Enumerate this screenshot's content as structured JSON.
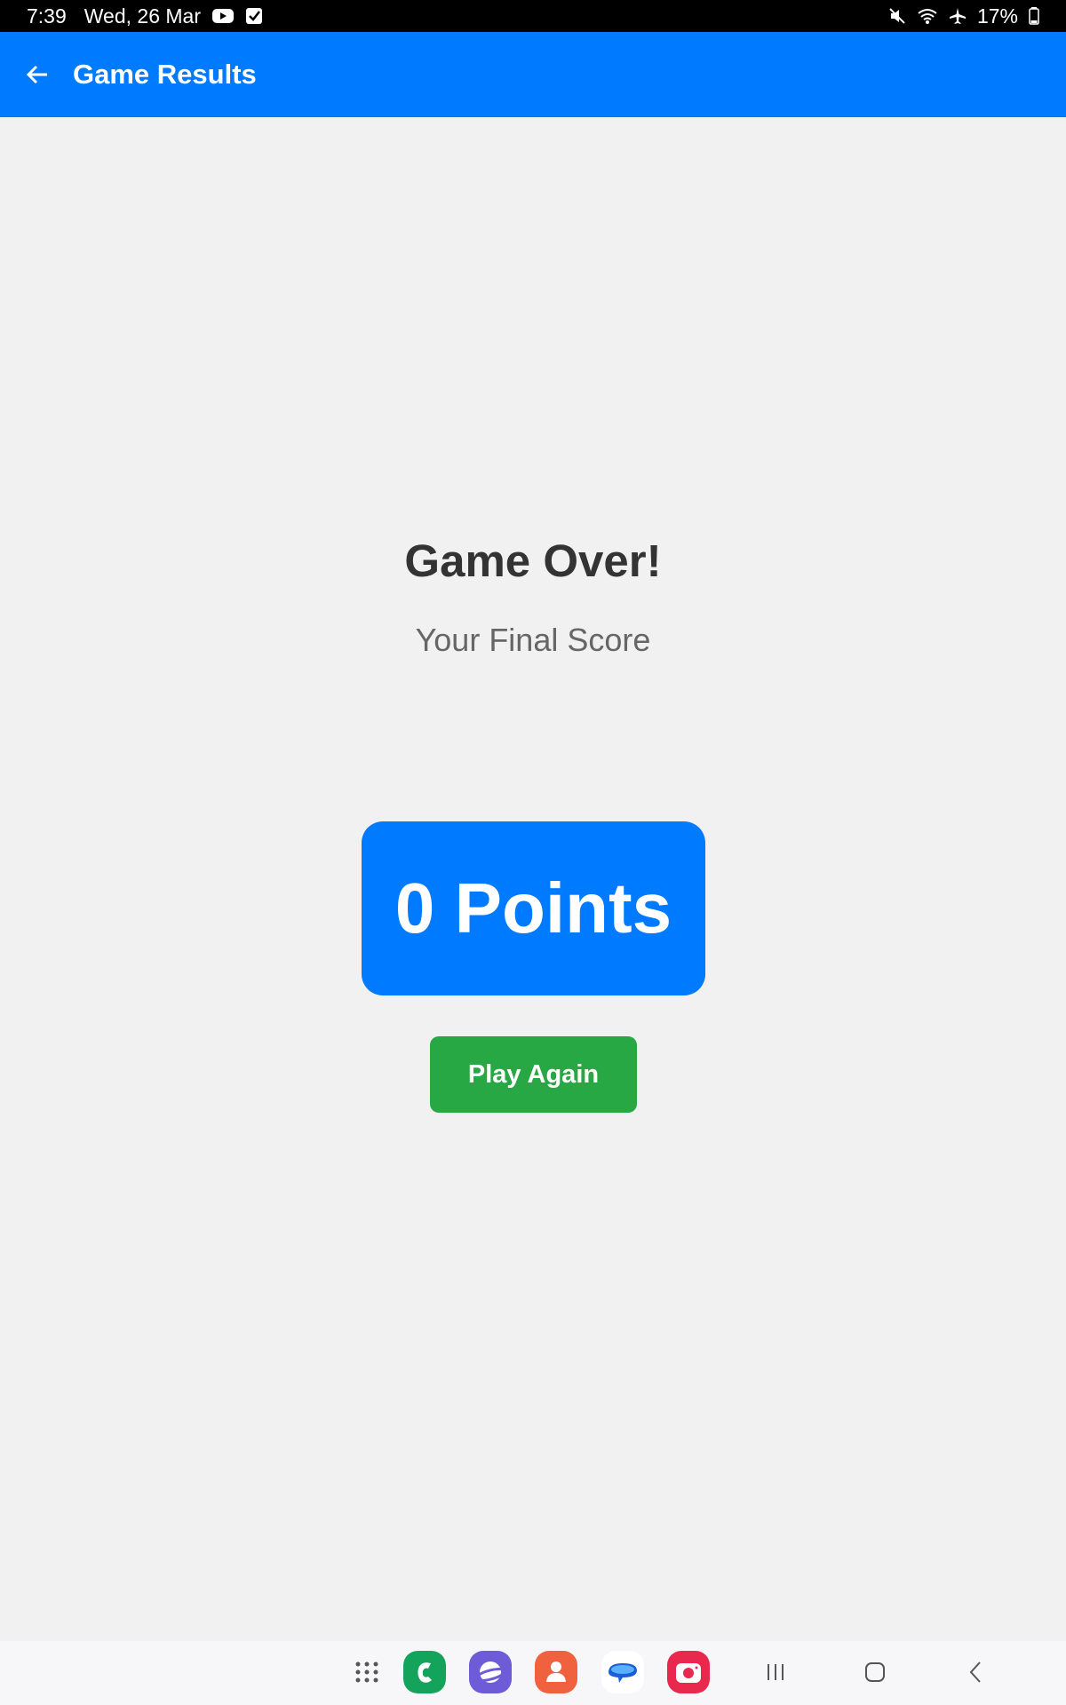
{
  "status_bar": {
    "time": "7:39",
    "date": "Wed, 26 Mar",
    "battery": "17%",
    "icons": [
      "youtube-icon",
      "checkbox-icon",
      "mute-icon",
      "wifi-icon",
      "airplane-icon",
      "battery-icon"
    ]
  },
  "app_bar": {
    "title": "Game Results",
    "back_icon": "arrow-left-icon"
  },
  "main": {
    "heading": "Game Over!",
    "subheading": "Your Final Score",
    "score_text": "0 Points",
    "play_again_label": "Play Again"
  },
  "colors": {
    "primary": "#007bff",
    "success": "#28a745",
    "background": "#f1f1f1",
    "heading": "#333333",
    "subheading": "#666666"
  },
  "nav_bar": {
    "apps": [
      "app-drawer-icon",
      "phone-app-icon",
      "internet-app-icon",
      "contacts-app-icon",
      "messages-app-icon",
      "camera-app-icon"
    ],
    "buttons": [
      "recents-icon",
      "home-icon",
      "back-icon"
    ]
  }
}
